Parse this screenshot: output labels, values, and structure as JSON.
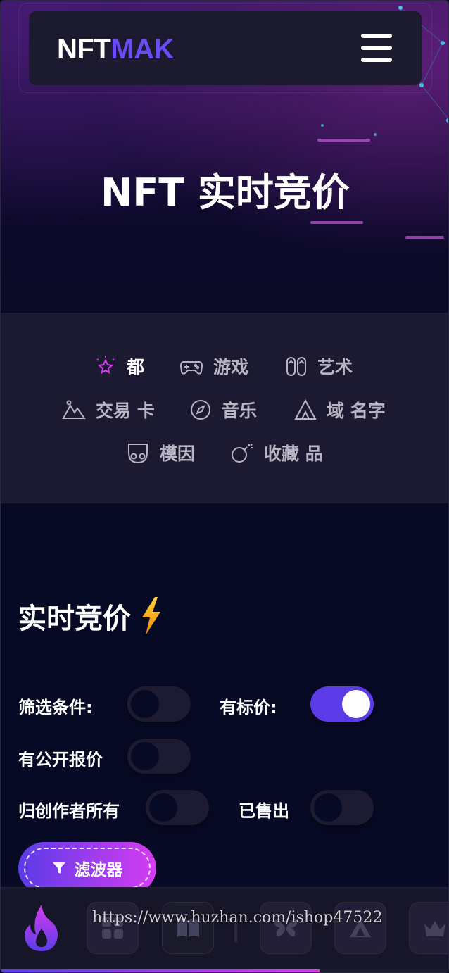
{
  "header": {
    "logo_part1": "NFT",
    "logo_part2": "MAK",
    "menu_icon": "hamburger-menu-icon"
  },
  "hero": {
    "title": "NFT 实时竞价"
  },
  "categories": [
    {
      "label": "都",
      "icon": "sparkle-icon",
      "active": true
    },
    {
      "label": "游戏",
      "icon": "gamepad-icon",
      "active": false
    },
    {
      "label": "艺术",
      "icon": "flip-flops-icon",
      "active": false
    },
    {
      "label": "交易 卡",
      "icon": "mountain-icon",
      "active": false
    },
    {
      "label": "音乐",
      "icon": "compass-icon",
      "active": false
    },
    {
      "label": "域 名字",
      "icon": "tent-icon",
      "active": false
    },
    {
      "label": "模因",
      "icon": "mask-icon",
      "active": false
    },
    {
      "label": "收藏 品",
      "icon": "bomb-icon",
      "active": false
    }
  ],
  "live_auction": {
    "title": "实时竞价",
    "title_icon": "lightning-bolt-icon",
    "filters": [
      {
        "label": "筛选条件:",
        "on": false
      },
      {
        "label": "有标价:",
        "on": true
      },
      {
        "label": "有公开报价",
        "on": false
      },
      {
        "label": "归创作者所有",
        "on": false
      },
      {
        "label": "已售出",
        "on": false
      }
    ],
    "filter_button_label": "滤波器",
    "filter_button_icon": "funnel-icon"
  },
  "bottom_bar": {
    "logo_icon": "flame-icon",
    "buttons": [
      "grid-icon",
      "book-icon",
      "butterfly-icon",
      "triangle-icon",
      "crown-icon"
    ],
    "progress_fraction": 0.71
  },
  "watermark": "https://www.huzhan.com/ishop47522",
  "colors": {
    "accent_purple": "#5b3be8",
    "accent_pink": "#d53cf0",
    "background": "#070a24",
    "panel": "#1c1a30"
  }
}
